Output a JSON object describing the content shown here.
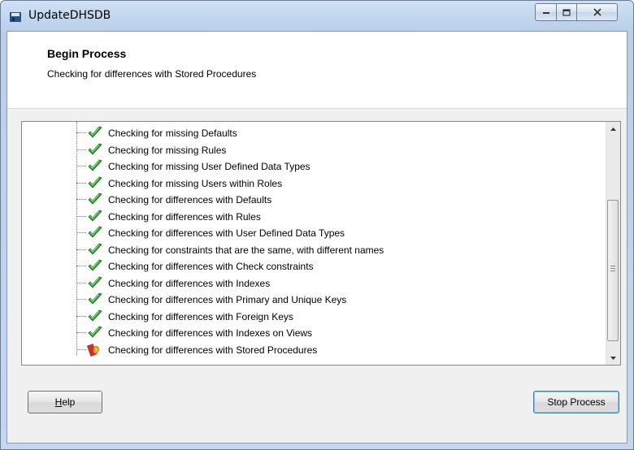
{
  "window": {
    "title": "UpdateDHSDB",
    "controls": {
      "minimize": "minimize",
      "maximize": "maximize",
      "close": "close"
    }
  },
  "header": {
    "title": "Begin Process",
    "subtitle": "Checking for differences with Stored Procedures"
  },
  "tree": {
    "items": [
      {
        "label": "Checking for missing Defaults",
        "status": "check-icon"
      },
      {
        "label": "Checking for missing Rules",
        "status": "check-icon"
      },
      {
        "label": "Checking for missing User Defined Data Types",
        "status": "check-icon"
      },
      {
        "label": "Checking for missing Users within Roles",
        "status": "check-icon"
      },
      {
        "label": "Checking for differences with Defaults",
        "status": "check-icon"
      },
      {
        "label": "Checking for differences with Rules",
        "status": "check-icon"
      },
      {
        "label": "Checking for differences with User Defined Data Types",
        "status": "check-icon"
      },
      {
        "label": "Checking for constraints that are the same, with different names",
        "status": "check-icon"
      },
      {
        "label": "Checking for differences with Check constraints",
        "status": "check-icon"
      },
      {
        "label": "Checking for differences with Indexes",
        "status": "check-icon"
      },
      {
        "label": "Checking for differences with Primary and Unique Keys",
        "status": "check-icon"
      },
      {
        "label": "Checking for differences with Foreign Keys",
        "status": "check-icon"
      },
      {
        "label": "Checking for differences with Indexes on Views",
        "status": "check-icon"
      },
      {
        "label": "Checking for differences with Stored Procedures",
        "status": "in-progress-icon"
      }
    ]
  },
  "buttons": {
    "help_first": "H",
    "help_rest": "elp",
    "stop": "Stop Process"
  },
  "colors": {
    "check_green": "#3aa53a",
    "accent_blue": "#3c7fb1"
  }
}
